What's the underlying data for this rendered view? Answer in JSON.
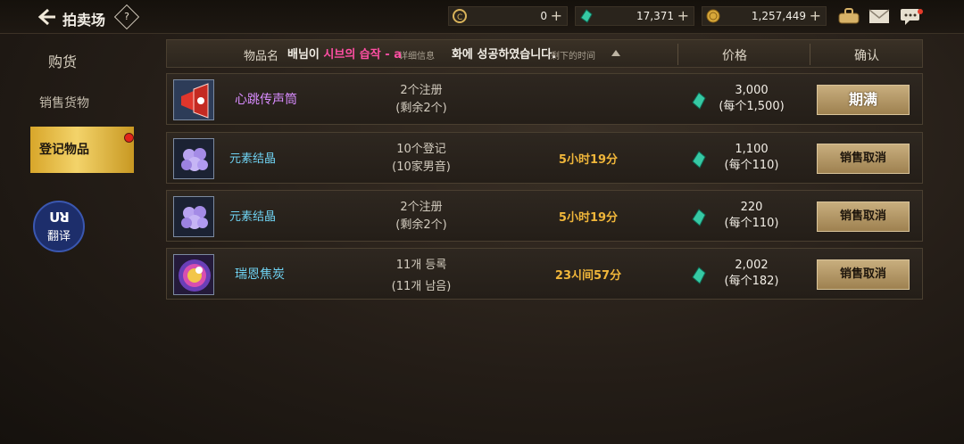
{
  "topbar": {
    "title": "拍卖场",
    "help": "?",
    "currency1": {
      "icon": "gold-coin-c-icon",
      "value": "0"
    },
    "currency2": {
      "icon": "green-gem-icon",
      "value": "17,371"
    },
    "currency3": {
      "icon": "gold-coin-icon",
      "value": "1,257,449"
    },
    "plus": "+"
  },
  "sidebar": {
    "buy": "购货",
    "sell": "销售货物",
    "registered": "登记物品",
    "translate_logo": "ꓴꓤ",
    "translate": "翻译"
  },
  "header": {
    "item_name": "物品名",
    "detail": "详细信息",
    "remaining": "剩下的时间",
    "price": "价格",
    "confirm": "确认"
  },
  "toast": {
    "prefix": "배님이 ",
    "highlight": "시브의 습작 - ",
    "cut": "a",
    "suffix": "화에 성공하였습니다."
  },
  "rows": [
    {
      "name": "心跳传声筒",
      "qty1": "2个注册",
      "qty2": "(剩余2个)",
      "time": "",
      "price": "3,000",
      "unit": "(每个1,500)",
      "button": "期满",
      "icon": "megaphone-icon"
    },
    {
      "name": "元素结晶",
      "qty1": "10个登记",
      "qty2": "(10家男音)",
      "time": "5小时19分",
      "price": "1,100",
      "unit": "(每个110)",
      "button": "销售取消",
      "icon": "purple-crystal-icon"
    },
    {
      "name": "元素结晶",
      "qty1": "2个注册",
      "qty2": "(剩余2个)",
      "time": "5小时19分",
      "price": "220",
      "unit": "(每个110)",
      "button": "销售取消",
      "icon": "purple-crystal-icon"
    },
    {
      "name": "瑞恩焦炭",
      "qty1": "11개 등록",
      "qty2": "(11개 남음)",
      "time": "23시间57分",
      "price": "2,002",
      "unit": "(每个182)",
      "button": "销售取消",
      "icon": "rainbow-orb-icon"
    }
  ],
  "colors": {
    "accent_gold": "#e3b94a",
    "time_orange": "#f0b63a",
    "name_purple": "#d98cff",
    "name_cyan": "#6fd2f2"
  }
}
